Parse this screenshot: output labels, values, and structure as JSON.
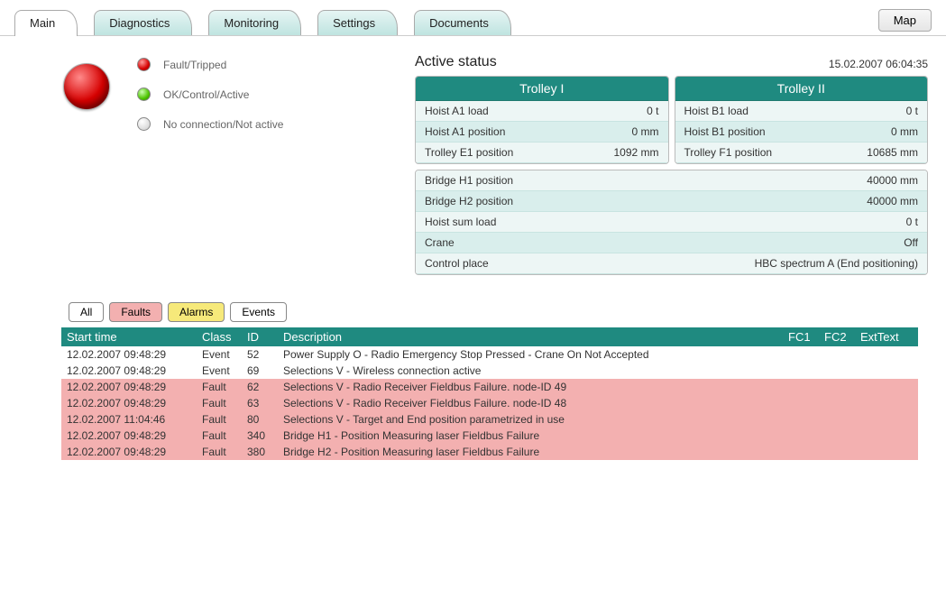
{
  "tabs": [
    "Main",
    "Diagnostics",
    "Monitoring",
    "Settings",
    "Documents"
  ],
  "active_tab": "Main",
  "map_button": "Map",
  "legend": {
    "fault": "Fault/Tripped",
    "ok": "OK/Control/Active",
    "none": "No connection/Not active"
  },
  "status": {
    "title": "Active status",
    "timestamp": "15.02.2007 06:04:35",
    "trolley1": {
      "header": "Trolley I",
      "rows": [
        {
          "label": "Hoist A1 load",
          "value": "0 t"
        },
        {
          "label": "Hoist A1 position",
          "value": "0 mm"
        },
        {
          "label": "Trolley E1 position",
          "value": "1092 mm"
        }
      ]
    },
    "trolley2": {
      "header": "Trolley II",
      "rows": [
        {
          "label": "Hoist B1 load",
          "value": "0 t"
        },
        {
          "label": "Hoist B1 position",
          "value": "0 mm"
        },
        {
          "label": "Trolley F1 position",
          "value": "10685 mm"
        }
      ]
    },
    "bridge": [
      {
        "label": "Bridge H1 position",
        "value": "40000 mm"
      },
      {
        "label": "Bridge H2 position",
        "value": "40000 mm"
      },
      {
        "label": "Hoist sum load",
        "value": "0 t"
      },
      {
        "label": "Crane",
        "value": "Off"
      },
      {
        "label": "Control place",
        "value": "HBC spectrum A (End positioning)"
      }
    ]
  },
  "filters": {
    "all": "All",
    "faults": "Faults",
    "alarms": "Alarms",
    "events": "Events"
  },
  "event_table": {
    "headers": {
      "start": "Start time",
      "class": "Class",
      "id": "ID",
      "desc": "Description",
      "fc1": "FC1",
      "fc2": "FC2",
      "ext": "ExtText"
    },
    "rows": [
      {
        "start": "12.02.2007 09:48:29",
        "class": "Event",
        "id": "52",
        "desc": "Power Supply O - Radio Emergency Stop Pressed - Crane On Not Accepted",
        "fault": false
      },
      {
        "start": "12.02.2007 09:48:29",
        "class": "Event",
        "id": "69",
        "desc": "Selections V - Wireless connection active",
        "fault": false
      },
      {
        "start": "12.02.2007 09:48:29",
        "class": "Fault",
        "id": "62",
        "desc": "Selections V - Radio Receiver Fieldbus Failure. node-ID 49",
        "fault": true
      },
      {
        "start": "12.02.2007 09:48:29",
        "class": "Fault",
        "id": "63",
        "desc": "Selections V - Radio Receiver Fieldbus Failure. node-ID 48",
        "fault": true
      },
      {
        "start": "12.02.2007 11:04:46",
        "class": "Fault",
        "id": "80",
        "desc": "Selections V - Target and End position parametrized in use",
        "fault": true
      },
      {
        "start": "12.02.2007 09:48:29",
        "class": "Fault",
        "id": "340",
        "desc": "Bridge H1 - Position Measuring laser Fieldbus Failure",
        "fault": true
      },
      {
        "start": "12.02.2007 09:48:29",
        "class": "Fault",
        "id": "380",
        "desc": "Bridge H2 - Position Measuring laser Fieldbus Failure",
        "fault": true
      }
    ]
  }
}
